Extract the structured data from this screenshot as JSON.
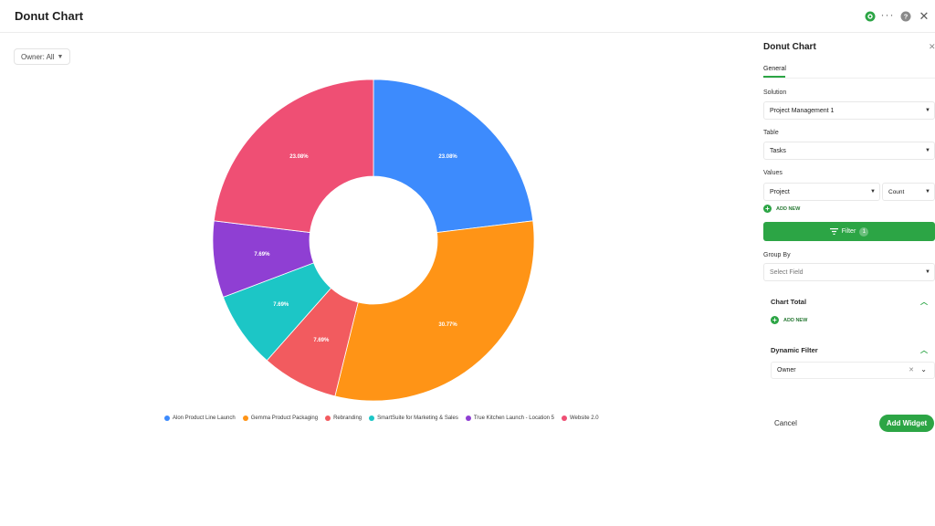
{
  "header": {
    "title": "Donut Chart",
    "more_icon": "more-dots-icon",
    "close_glyph": "✕"
  },
  "filters": {
    "owner_label": "Owner: All"
  },
  "chart_data": {
    "type": "pie",
    "categories": [
      "Alon Product Line Launch",
      "Gemma Product Packaging",
      "Rebranding",
      "SmartSuite for Marketing & Sales",
      "True Kitchen Launch - Location 5",
      "Website 2.0"
    ],
    "values": [
      23.08,
      30.77,
      7.69,
      7.69,
      7.69,
      23.08
    ],
    "labels": [
      "23.08%",
      "30.77%",
      "7.69%",
      "7.69%",
      "7.69%",
      "23.08%"
    ],
    "colors": [
      "#3d8bfd",
      "#ff9416",
      "#f25b5f",
      "#1cc6c6",
      "#8f3fd3",
      "#ef4f74"
    ],
    "donut": true,
    "legend_position": "bottom"
  },
  "panel": {
    "title": "Donut Chart",
    "close_glyph": "✕",
    "tab_general": "General",
    "solution_label": "Solution",
    "solution_value": "Project Management 1",
    "table_label": "Table",
    "table_value": "Tasks",
    "values_label": "Values",
    "values_field": "Project",
    "values_agg": "Count",
    "add_new": "ADD NEW",
    "filter_label": "Filter",
    "filter_count": "1",
    "group_by_label": "Group By",
    "group_by_placeholder": "Select Field",
    "chart_total_label": "Chart Total",
    "dynamic_filter_label": "Dynamic Filter",
    "dynamic_filter_value": "Owner",
    "cancel_label": "Cancel",
    "add_widget_label": "Add Widget"
  }
}
